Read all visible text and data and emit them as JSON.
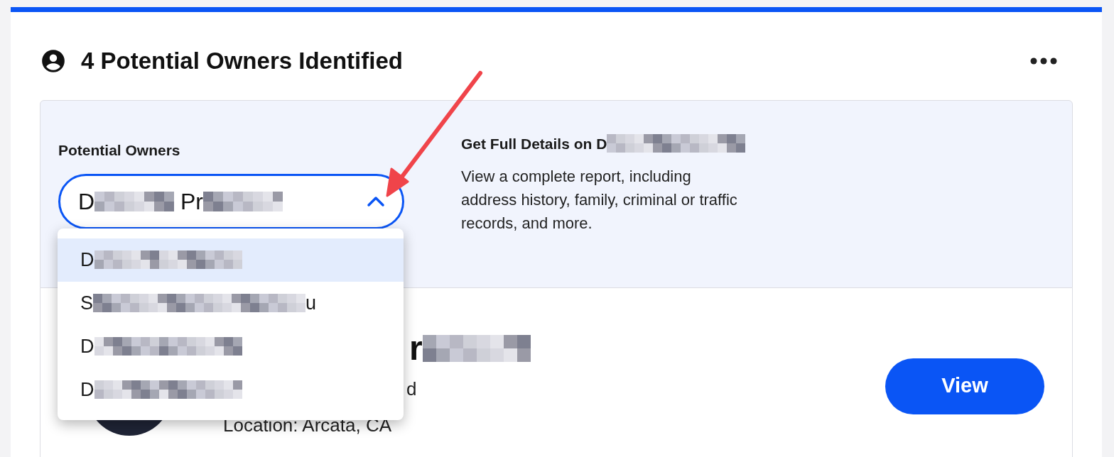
{
  "header": {
    "title": "4 Potential Owners Identified"
  },
  "selector": {
    "label": "Potential Owners",
    "expanded": true,
    "value": [
      {
        "kind": "text",
        "text": "D"
      },
      {
        "kind": "redacted"
      },
      {
        "kind": "text",
        "text": " Pr"
      },
      {
        "kind": "redacted"
      }
    ],
    "options": [
      {
        "selected": true,
        "name": [
          {
            "kind": "text",
            "text": "D"
          },
          {
            "kind": "redacted"
          },
          {
            "kind": "redacted"
          }
        ]
      },
      {
        "selected": false,
        "name": [
          {
            "kind": "text",
            "text": "S"
          },
          {
            "kind": "redacted"
          },
          {
            "kind": "text",
            "text": "u"
          }
        ]
      },
      {
        "selected": false,
        "name": [
          {
            "kind": "text",
            "text": "D"
          },
          {
            "kind": "redacted"
          },
          {
            "kind": "redacted"
          }
        ]
      },
      {
        "selected": false,
        "name": [
          {
            "kind": "text",
            "text": "D"
          },
          {
            "kind": "redacted"
          },
          {
            "kind": "redacted"
          }
        ]
      }
    ]
  },
  "promo": {
    "title": [
      {
        "kind": "text",
        "text": "Get Full Details on D"
      },
      {
        "kind": "redacted"
      }
    ],
    "description": "View a complete report, including address history, family, criminal or traffic records, and more."
  },
  "owner": {
    "name": [
      {
        "kind": "text",
        "text": "r"
      },
      {
        "kind": "redacted"
      }
    ],
    "detail": "d",
    "location": "Location: Arcata, CA",
    "button": "View"
  }
}
